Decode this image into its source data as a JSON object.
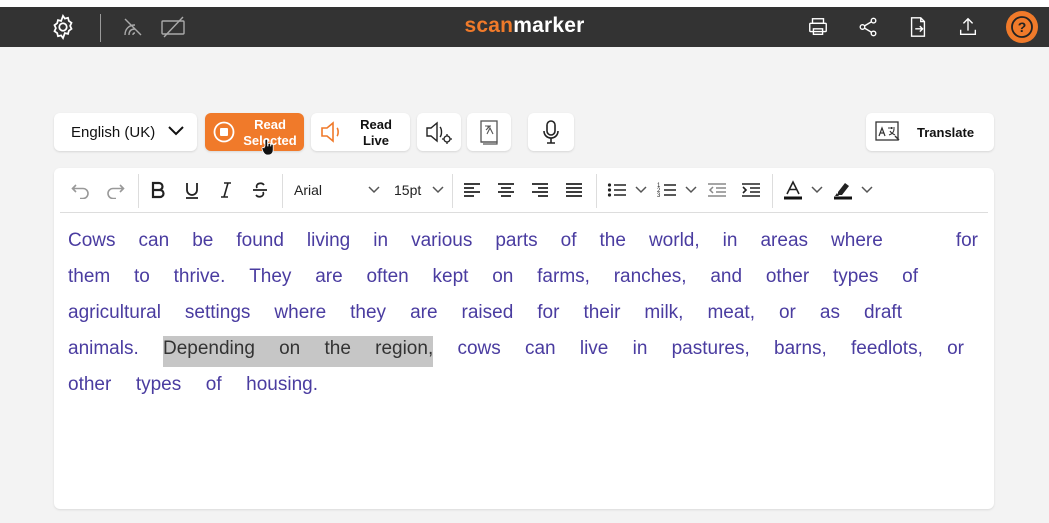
{
  "app": {
    "logo_prefix": "scan",
    "logo_suffix": "marker",
    "brand_color": "#f07a2a",
    "topbar_color": "#333333"
  },
  "topbar": {
    "left_icons": [
      "settings-icon",
      "scan-signal-icon",
      "crossed-frame-icon"
    ],
    "right_icons": [
      "print-icon",
      "share-icon",
      "export-document-icon",
      "upload-icon",
      "help-icon"
    ],
    "help_label": "?"
  },
  "toolbar": {
    "language": "English (UK)",
    "read_selected_line1": "Read",
    "read_selected_line2": "Selected",
    "read_live_line1": "Read",
    "read_live_line2": "Live",
    "translate_label": "Translate",
    "extra_icons": [
      "voice-settings-icon",
      "dictionary-icon",
      "microphone-icon"
    ]
  },
  "editor": {
    "font": "Arial",
    "font_size": "15pt",
    "text_color": "#4a3ca0",
    "highlight_color": "#c6c6c6",
    "lines": [
      [
        "Cows",
        "can",
        "be",
        "found",
        "living",
        "in",
        "various",
        "parts",
        "of",
        "the",
        "world,",
        "in",
        "areas",
        "where",
        "for"
      ],
      [
        "them",
        "to",
        "thrive.",
        "They",
        "are",
        "often",
        "kept",
        "on",
        "farms,",
        "ranches,",
        "and",
        "other",
        "types",
        "of"
      ],
      [
        "agricultural",
        "settings",
        "where",
        "they",
        "are",
        "raised",
        "for",
        "their",
        "milk,",
        "meat,",
        "or",
        "as",
        "draft"
      ],
      [
        "animals.",
        "Depending",
        "on",
        "the",
        "region,",
        "cows",
        "can",
        "live",
        "in",
        "pastures,",
        "barns,",
        "feedlots,",
        "or"
      ],
      [
        "other",
        "types",
        "of",
        "housing."
      ]
    ],
    "selected_text": "Depending on the region,"
  }
}
